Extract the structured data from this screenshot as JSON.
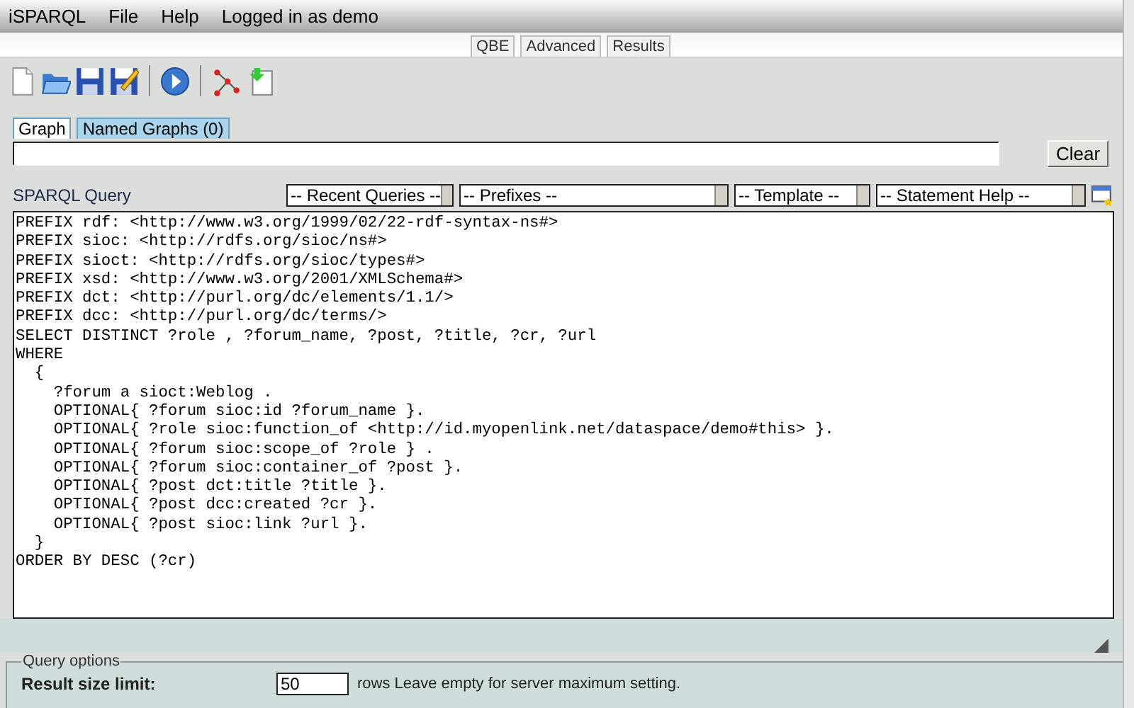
{
  "menu": [
    {
      "label": "iSPARQL"
    },
    {
      "label": "File"
    },
    {
      "label": "Help"
    },
    {
      "label": "Logged in as demo"
    }
  ],
  "view_tabs": [
    {
      "label": "QBE"
    },
    {
      "label": "Advanced"
    },
    {
      "label": "Results"
    }
  ],
  "graph_tabs": [
    {
      "label": "Graph",
      "selected": true
    },
    {
      "label": "Named Graphs (0)",
      "selected": false
    }
  ],
  "clear_button": "Clear",
  "query_label": "SPARQL Query",
  "dropdowns": [
    {
      "value": "-- Recent Queries --"
    },
    {
      "value": "-- Prefixes --"
    },
    {
      "value": "-- Template --"
    },
    {
      "value": "-- Statement Help --"
    }
  ],
  "query": "PREFIX rdf: <http://www.w3.org/1999/02/22-rdf-syntax-ns#>\nPREFIX sioc: <http://rdfs.org/sioc/ns#>\nPREFIX sioct: <http://rdfs.org/sioc/types#>\nPREFIX xsd: <http://www.w3.org/2001/XMLSchema#>\nPREFIX dct: <http://purl.org/dc/elements/1.1/>\nPREFIX dcc: <http://purl.org/dc/terms/>\nSELECT DISTINCT ?role , ?forum_name, ?post, ?title, ?cr, ?url\nWHERE\n  {\n    ?forum a sioct:Weblog .\n    OPTIONAL{ ?forum sioc:id ?forum_name }.\n    OPTIONAL{ ?role sioc:function_of <http://id.myopenlink.net/dataspace/demo#this> }.\n    OPTIONAL{ ?forum sioc:scope_of ?role } .\n    OPTIONAL{ ?forum sioc:container_of ?post }.\n    OPTIONAL{ ?post dct:title ?title }.\n    OPTIONAL{ ?post dcc:created ?cr }.\n    OPTIONAL{ ?post sioc:link ?url }.\n  }\nORDER BY DESC (?cr)",
  "query_options": {
    "legend": "Query options",
    "limit_label": "Result size limit:",
    "limit_value": "50",
    "limit_hint": "rows Leave empty for server maximum setting."
  }
}
